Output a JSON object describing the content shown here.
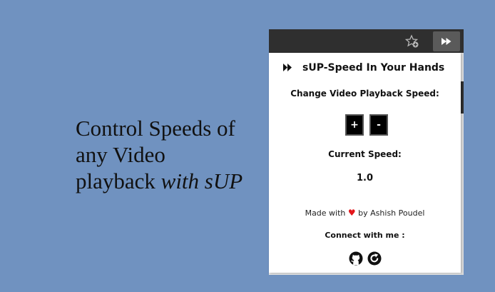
{
  "promo": {
    "line1": "Control Speeds of",
    "line2": "any Video",
    "line3": "playback",
    "line3_italic": "with sUP"
  },
  "popup": {
    "title": "sUP-Speed In Your Hands",
    "subtitle": "Change Video Playback Speed:",
    "plus_label": "+",
    "minus_label": "-",
    "current_speed_label": "Current Speed:",
    "current_speed_value": "1.0",
    "made_with_prefix": "Made with",
    "heart": "♥",
    "made_with_suffix": "by Ashish Poudel",
    "connect_label": "Connect with me :",
    "icons": [
      "github-icon",
      "refresh-icon"
    ]
  },
  "colors": {
    "background": "#7092c0",
    "browser_bar": "#2f2f2f",
    "heart": "#e3151a"
  }
}
